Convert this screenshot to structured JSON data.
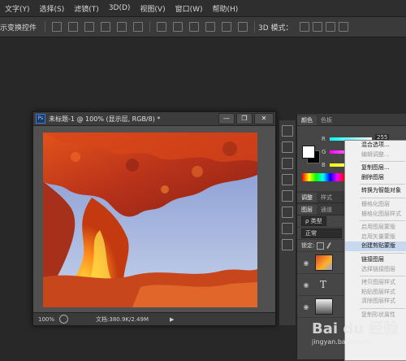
{
  "menubar": {
    "items": [
      "文字(Y)",
      "选择(S)",
      "滤镜(T)",
      "3D(D)",
      "视图(V)",
      "窗口(W)",
      "帮助(H)"
    ]
  },
  "options": {
    "transform_controls_label": "示变换控件",
    "mode_label": "3D 模式："
  },
  "document": {
    "ps_badge": "Ps",
    "title": "未标题-1 @ 100% (显示层, RGB/8) *",
    "zoom": "100%",
    "doc_size": "文档:380.9K/2.49M",
    "minimize": "—",
    "restore": "❐",
    "close": "✕"
  },
  "color_panel": {
    "tabs": [
      "颜色",
      "色板"
    ],
    "channels": [
      "R",
      "G",
      "B"
    ],
    "r_value": "255"
  },
  "layers_panel": {
    "tabs": [
      "调整",
      "样式"
    ],
    "sub_tabs": [
      "图层",
      "通道"
    ],
    "filter_label": "ρ 类型",
    "blend_mode": "正常",
    "lock_label": "锁定:"
  },
  "context_menu": {
    "items": [
      {
        "label": "混合选项...",
        "state": "normal"
      },
      {
        "label": "编辑调整...",
        "state": "disabled"
      },
      {
        "label": "复制图层...",
        "state": "normal"
      },
      {
        "label": "删除图层",
        "state": "normal"
      },
      {
        "label": "转换为智能对象",
        "state": "normal"
      },
      {
        "label": "栅格化图层",
        "state": "disabled"
      },
      {
        "label": "栅格化图层样式",
        "state": "disabled"
      },
      {
        "label": "启用图层蒙版",
        "state": "disabled"
      },
      {
        "label": "启用矢量蒙版",
        "state": "disabled"
      },
      {
        "label": "创建剪贴蒙版",
        "state": "highlight"
      },
      {
        "label": "链接图层",
        "state": "normal"
      },
      {
        "label": "选择链接图层",
        "state": "disabled"
      },
      {
        "label": "拷贝图层样式",
        "state": "disabled"
      },
      {
        "label": "粘贴图层样式",
        "state": "disabled"
      },
      {
        "label": "清除图层样式",
        "state": "disabled"
      },
      {
        "label": "复制形状属性",
        "state": "disabled"
      }
    ]
  },
  "watermark": {
    "brand": "Bai du 经验",
    "url": "jingyan.baidu.com"
  },
  "colors": {
    "workspace": "#282828",
    "panel": "#464646",
    "highlight": "#c8d8ee"
  }
}
